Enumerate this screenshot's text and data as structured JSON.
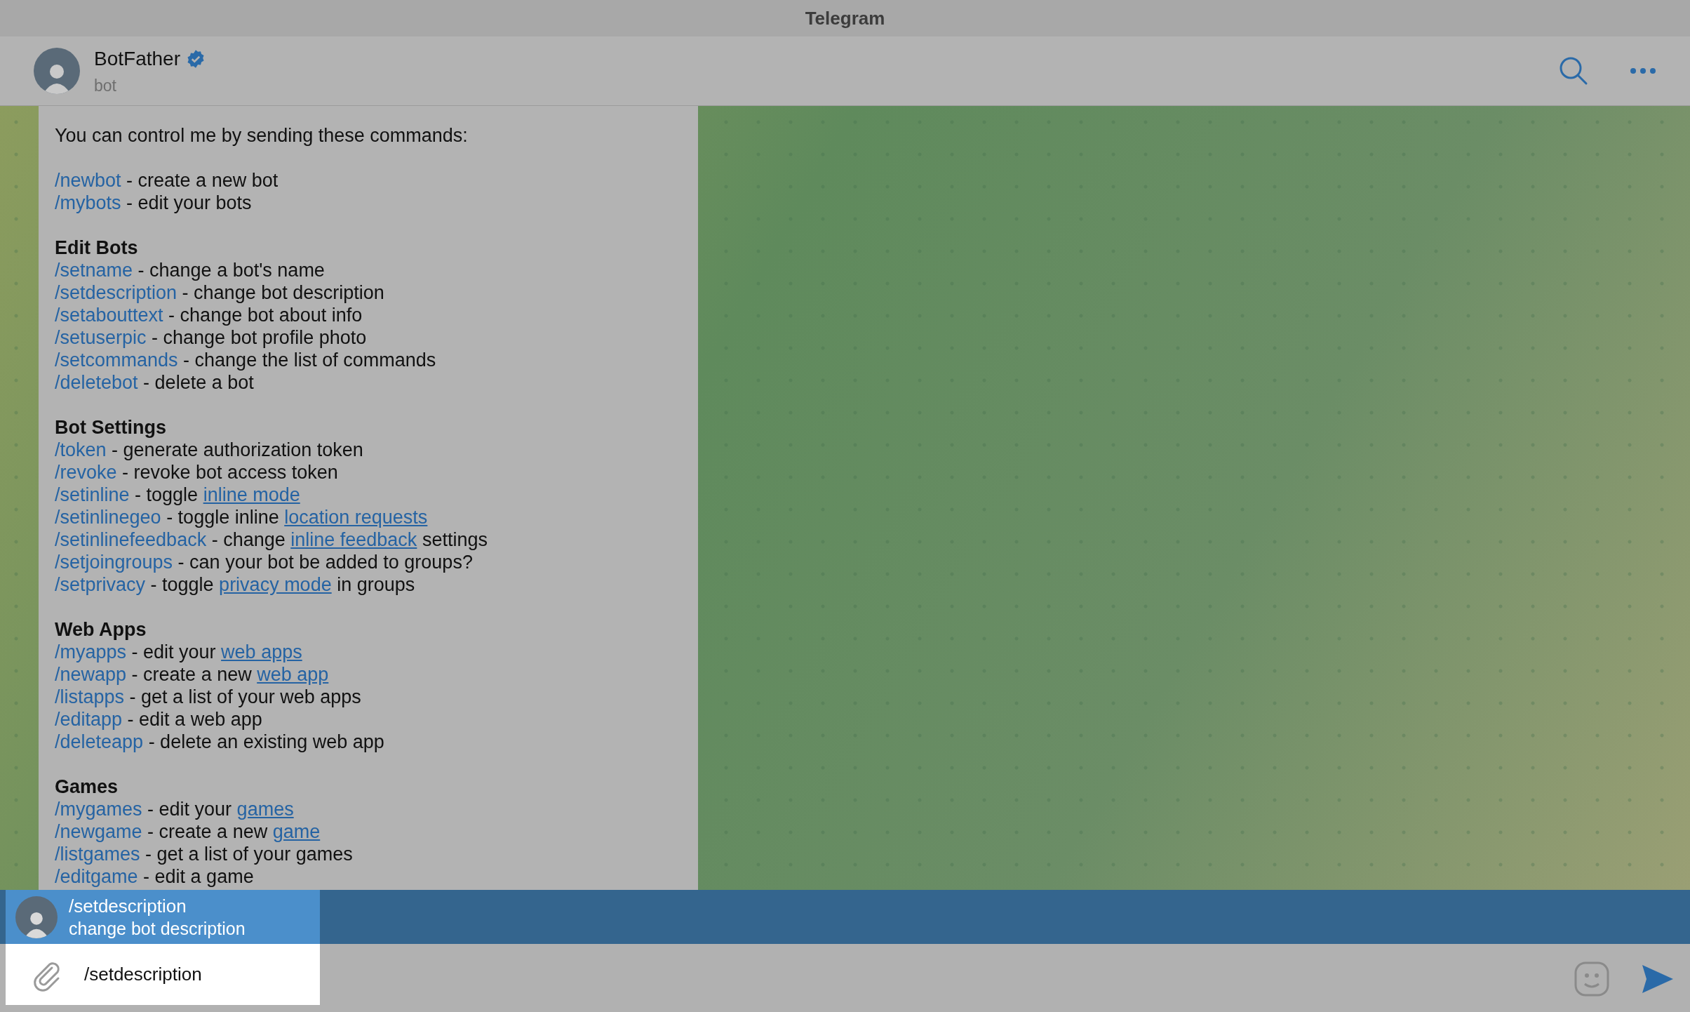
{
  "window": {
    "title": "Telegram"
  },
  "chat_header": {
    "name": "BotFather",
    "verified": true,
    "subtitle": "bot"
  },
  "message": {
    "lines": [
      {
        "kind": "text",
        "parts": [
          {
            "kind": "text",
            "text": "You can control me by sending these commands:"
          }
        ]
      },
      {
        "kind": "blank"
      },
      {
        "kind": "text",
        "parts": [
          {
            "kind": "command",
            "text": "/newbot"
          },
          {
            "kind": "text",
            "text": " - create a new bot"
          }
        ]
      },
      {
        "kind": "text",
        "parts": [
          {
            "kind": "command",
            "text": "/mybots"
          },
          {
            "kind": "text",
            "text": " - edit your bots"
          }
        ]
      },
      {
        "kind": "blank"
      },
      {
        "kind": "heading",
        "parts": [
          {
            "kind": "text",
            "text": "Edit Bots"
          }
        ]
      },
      {
        "kind": "text",
        "parts": [
          {
            "kind": "command",
            "text": "/setname"
          },
          {
            "kind": "text",
            "text": " - change a bot's name"
          }
        ]
      },
      {
        "kind": "text",
        "parts": [
          {
            "kind": "command",
            "text": "/setdescription"
          },
          {
            "kind": "text",
            "text": " - change bot description"
          }
        ]
      },
      {
        "kind": "text",
        "parts": [
          {
            "kind": "command",
            "text": "/setabouttext"
          },
          {
            "kind": "text",
            "text": " - change bot about info"
          }
        ]
      },
      {
        "kind": "text",
        "parts": [
          {
            "kind": "command",
            "text": "/setuserpic"
          },
          {
            "kind": "text",
            "text": " - change bot profile photo"
          }
        ]
      },
      {
        "kind": "text",
        "parts": [
          {
            "kind": "command",
            "text": "/setcommands"
          },
          {
            "kind": "text",
            "text": " - change the list of commands"
          }
        ]
      },
      {
        "kind": "text",
        "parts": [
          {
            "kind": "command",
            "text": "/deletebot"
          },
          {
            "kind": "text",
            "text": " - delete a bot"
          }
        ]
      },
      {
        "kind": "blank"
      },
      {
        "kind": "heading",
        "parts": [
          {
            "kind": "text",
            "text": "Bot Settings"
          }
        ]
      },
      {
        "kind": "text",
        "parts": [
          {
            "kind": "command",
            "text": "/token"
          },
          {
            "kind": "text",
            "text": " - generate authorization token"
          }
        ]
      },
      {
        "kind": "text",
        "parts": [
          {
            "kind": "command",
            "text": "/revoke"
          },
          {
            "kind": "text",
            "text": " - revoke bot access token"
          }
        ]
      },
      {
        "kind": "text",
        "parts": [
          {
            "kind": "command",
            "text": "/setinline"
          },
          {
            "kind": "text",
            "text": " - toggle "
          },
          {
            "kind": "link",
            "text": "inline mode"
          }
        ]
      },
      {
        "kind": "text",
        "parts": [
          {
            "kind": "command",
            "text": "/setinlinegeo"
          },
          {
            "kind": "text",
            "text": " - toggle inline "
          },
          {
            "kind": "link",
            "text": "location requests"
          }
        ]
      },
      {
        "kind": "text",
        "parts": [
          {
            "kind": "command",
            "text": "/setinlinefeedback"
          },
          {
            "kind": "text",
            "text": " - change "
          },
          {
            "kind": "link",
            "text": "inline feedback"
          },
          {
            "kind": "text",
            "text": " settings"
          }
        ]
      },
      {
        "kind": "text",
        "parts": [
          {
            "kind": "command",
            "text": "/setjoingroups"
          },
          {
            "kind": "text",
            "text": " - can your bot be added to groups?"
          }
        ]
      },
      {
        "kind": "text",
        "parts": [
          {
            "kind": "command",
            "text": "/setprivacy"
          },
          {
            "kind": "text",
            "text": " - toggle "
          },
          {
            "kind": "link",
            "text": "privacy mode"
          },
          {
            "kind": "text",
            "text": " in groups"
          }
        ]
      },
      {
        "kind": "blank"
      },
      {
        "kind": "heading",
        "parts": [
          {
            "kind": "text",
            "text": "Web Apps"
          }
        ]
      },
      {
        "kind": "text",
        "parts": [
          {
            "kind": "command",
            "text": "/myapps"
          },
          {
            "kind": "text",
            "text": " - edit your "
          },
          {
            "kind": "link",
            "text": "web apps"
          }
        ]
      },
      {
        "kind": "text",
        "parts": [
          {
            "kind": "command",
            "text": "/newapp"
          },
          {
            "kind": "text",
            "text": " - create a new "
          },
          {
            "kind": "link",
            "text": "web app"
          }
        ]
      },
      {
        "kind": "text",
        "parts": [
          {
            "kind": "command",
            "text": "/listapps"
          },
          {
            "kind": "text",
            "text": " - get a list of your web apps"
          }
        ]
      },
      {
        "kind": "text",
        "parts": [
          {
            "kind": "command",
            "text": "/editapp"
          },
          {
            "kind": "text",
            "text": " - edit a web app"
          }
        ]
      },
      {
        "kind": "text",
        "parts": [
          {
            "kind": "command",
            "text": "/deleteapp"
          },
          {
            "kind": "text",
            "text": " - delete an existing web app"
          }
        ]
      },
      {
        "kind": "blank"
      },
      {
        "kind": "heading",
        "parts": [
          {
            "kind": "text",
            "text": "Games"
          }
        ]
      },
      {
        "kind": "text",
        "parts": [
          {
            "kind": "command",
            "text": "/mygames"
          },
          {
            "kind": "text",
            "text": " - edit your "
          },
          {
            "kind": "link",
            "text": "games"
          }
        ]
      },
      {
        "kind": "text",
        "parts": [
          {
            "kind": "command",
            "text": "/newgame"
          },
          {
            "kind": "text",
            "text": " - create a new "
          },
          {
            "kind": "link",
            "text": "game"
          }
        ]
      },
      {
        "kind": "text",
        "parts": [
          {
            "kind": "command",
            "text": "/listgames"
          },
          {
            "kind": "text",
            "text": " - get a list of your games"
          }
        ]
      },
      {
        "kind": "text",
        "parts": [
          {
            "kind": "command",
            "text": "/editgame"
          },
          {
            "kind": "text",
            "text": " - edit a game"
          }
        ]
      }
    ]
  },
  "suggestions": [
    {
      "command": "/setdescription",
      "description": "change bot description",
      "selected": true
    }
  ],
  "composer": {
    "value": "/setdescription"
  }
}
